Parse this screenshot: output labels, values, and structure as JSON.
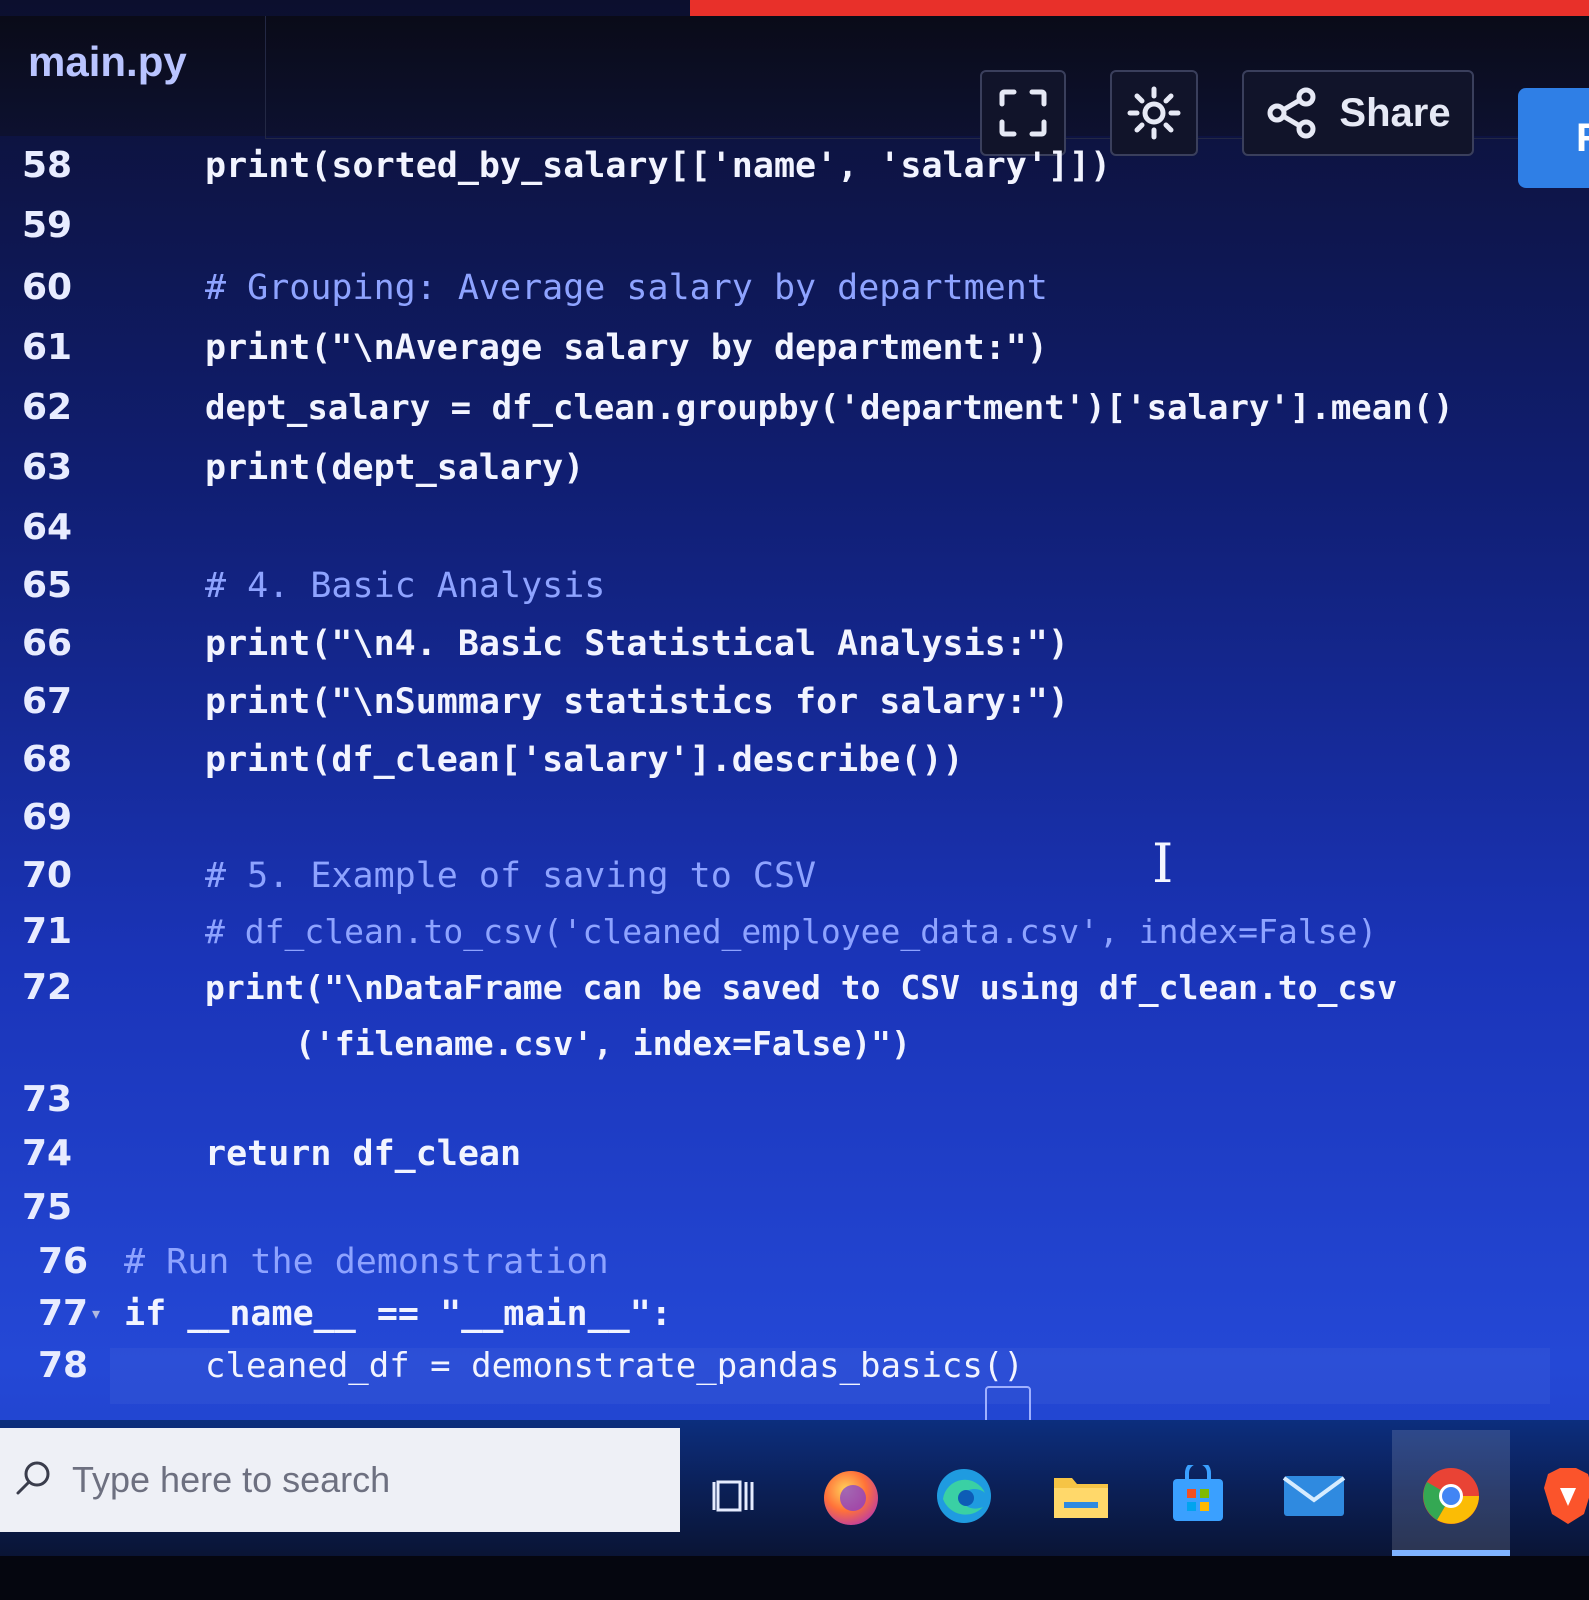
{
  "editor": {
    "file_tab": "main.py",
    "toolbar": {
      "fullscreen_icon": "fullscreen-icon",
      "settings_icon": "gear-icon",
      "share_label": "Share",
      "share_icon": "share-icon",
      "run_label_partial": "R"
    }
  },
  "code": {
    "lines": [
      {
        "num": "58",
        "text": "print(sorted_by_salary[['name', 'salary']])"
      },
      {
        "num": "59",
        "text": ""
      },
      {
        "num": "60",
        "text": "# Grouping: Average salary by department"
      },
      {
        "num": "61",
        "text": "print(\"\\nAverage salary by department:\")"
      },
      {
        "num": "62",
        "text": "dept_salary = df_clean.groupby('department')['salary'].mean()"
      },
      {
        "num": "63",
        "text": "print(dept_salary)"
      },
      {
        "num": "64",
        "text": ""
      },
      {
        "num": "65",
        "text": "# 4. Basic Analysis"
      },
      {
        "num": "66",
        "text": "print(\"\\n4. Basic Statistical Analysis:\")"
      },
      {
        "num": "67",
        "text": "print(\"\\nSummary statistics for salary:\")"
      },
      {
        "num": "68",
        "text": "print(df_clean['salary'].describe())"
      },
      {
        "num": "69",
        "text": ""
      },
      {
        "num": "70",
        "text": "# 5. Example of saving to CSV"
      },
      {
        "num": "71",
        "text": "# df_clean.to_csv('cleaned_employee_data.csv', index=False)"
      },
      {
        "num": "72",
        "text": "print(\"\\nDataFrame can be saved to CSV using df_clean.to_csv",
        "continuation": "('filename.csv', index=False)\")"
      },
      {
        "num": "73",
        "text": ""
      },
      {
        "num": "74",
        "text": "return df_clean"
      },
      {
        "num": "75",
        "text": ""
      },
      {
        "num": "76",
        "text": "# Run the demonstration"
      },
      {
        "num": "77",
        "text": "if __name__ == \"__main__\":"
      },
      {
        "num": "78",
        "text": "cleaned_df = demonstrate_pandas_basics()"
      }
    ]
  },
  "taskbar": {
    "search_placeholder": "Type here to search",
    "icons": [
      "task-view-icon",
      "firefox-icon",
      "edge-icon",
      "file-explorer-icon",
      "microsoft-store-icon",
      "mail-icon",
      "chrome-icon",
      "brave-icon"
    ]
  },
  "colors": {
    "accent_red": "#e8302a",
    "run_blue": "#2f7fe6",
    "comment": "#8ea3ff"
  }
}
